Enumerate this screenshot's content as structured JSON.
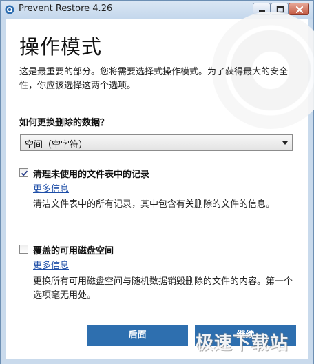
{
  "window": {
    "title": "Prevent Restore 4.26"
  },
  "page": {
    "heading": "操作模式",
    "intro": "这是最重要的部分。您将需要选择式操作模式。为了获得最大的安全性，你应该选择这两个选项。",
    "question": "如何更换删除的数据？",
    "select": {
      "value": "空间（空字符）"
    },
    "options": [
      {
        "label": "清理未使用的文件表中的记录",
        "checked": true,
        "more_link": "更多信息",
        "description": "清洁文件表中的所有记录，其中包含有关删除的文件的信息。"
      },
      {
        "label": "覆盖的可用磁盘空间",
        "checked": false,
        "more_link": "更多信息",
        "description": "更换所有可用磁盘空间与随机数据销毁删除的文件的内容。第一个选项毫无用处。"
      }
    ]
  },
  "buttons": {
    "back": "后面",
    "next": "继续"
  },
  "watermark_text": "极速下载站",
  "icons": {
    "app": "prevent-restore-app-icon",
    "minimize": "minimize-icon",
    "maximize": "maximize-icon",
    "close": "close-icon",
    "dropdown": "chevron-down-icon",
    "check": "checkmark-icon"
  },
  "colors": {
    "accent_button": "#2e6faf",
    "link": "#1f4fa8",
    "titlebar": "#c9daec"
  }
}
